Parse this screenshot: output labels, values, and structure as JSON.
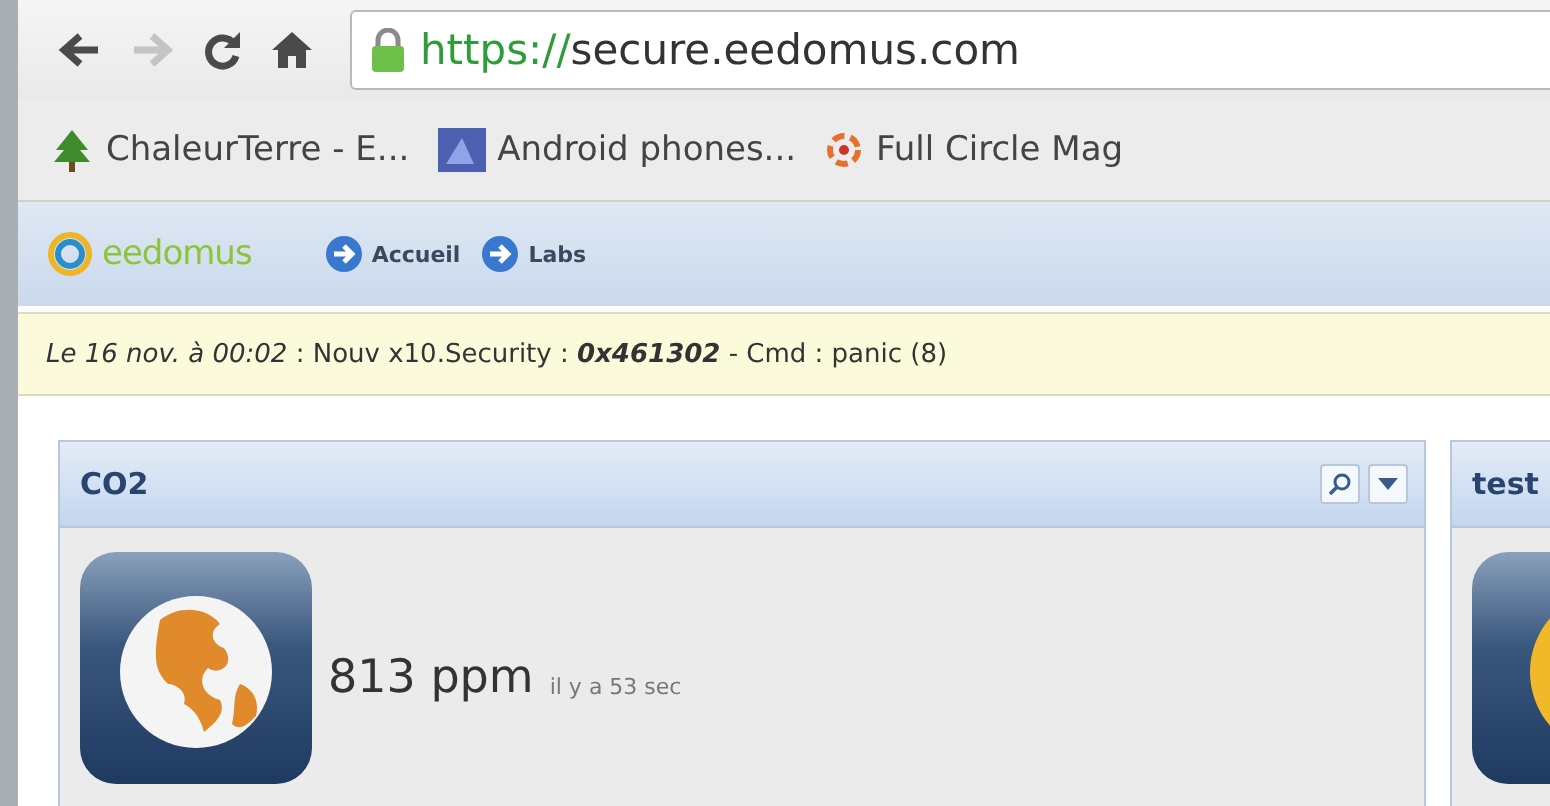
{
  "browser": {
    "url_scheme": "https://",
    "url_host": "secure.eedomus.com"
  },
  "bookmarks": [
    {
      "label": "ChaleurTerre - E...",
      "kind": "tree"
    },
    {
      "label": "Android phones...",
      "kind": "tile"
    },
    {
      "label": "Full Circle Mag",
      "kind": "logo"
    }
  ],
  "app_nav": {
    "brand": "eedomus",
    "links": [
      "Accueil",
      "Labs"
    ]
  },
  "notice": "*Le 16 nov. à 00:02* : Nouv x10.Security : **0x461302** - Cmd : panic (8)",
  "panels": [
    {
      "title": "CO2",
      "value": "813 ppm",
      "age": "il y a 53 sec",
      "kind": "globe"
    },
    {
      "title": "test",
      "kind": "ring"
    }
  ]
}
